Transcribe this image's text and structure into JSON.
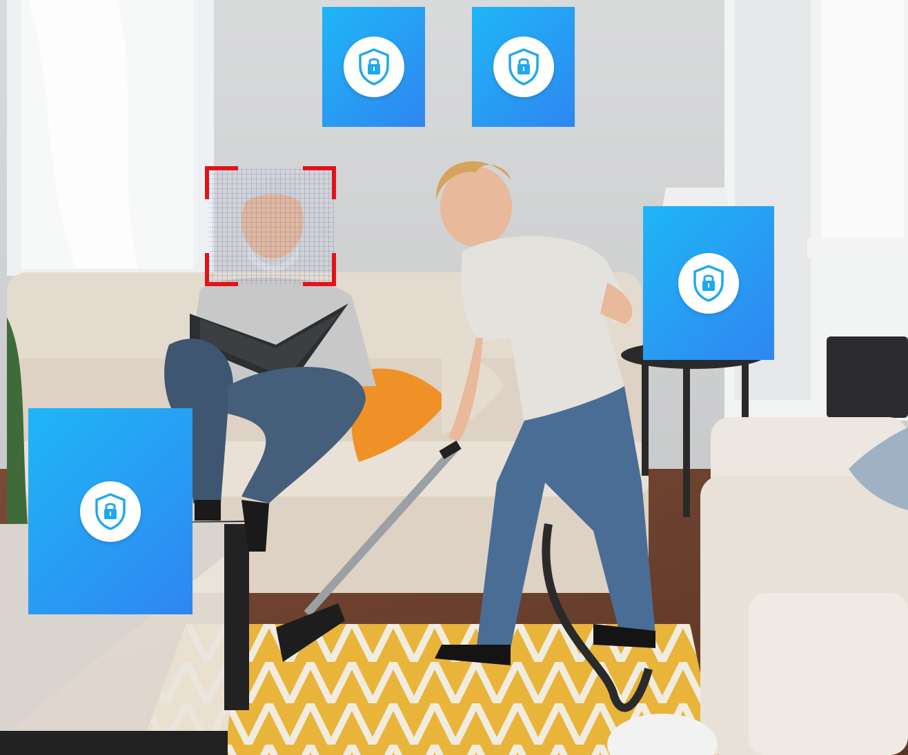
{
  "scene": {
    "description_icon_set": [
      "shield-lock-icon"
    ],
    "colors": {
      "card_gradient_start": "#1fb6f6",
      "card_gradient_end": "#2f86f1",
      "badge_background": "#ffffff",
      "icon_color": "#1fa9ee",
      "face_frame_color": "#e3121a",
      "face_grid_color": "#3b50c8"
    }
  },
  "privacy_cards": [
    {
      "id": "top-left",
      "icon": "shield-lock-icon"
    },
    {
      "id": "top-right",
      "icon": "shield-lock-icon"
    },
    {
      "id": "right",
      "icon": "shield-lock-icon"
    },
    {
      "id": "bottom-left",
      "icon": "shield-lock-icon"
    }
  ],
  "face_detection": {
    "icon": "face-scan-frame"
  }
}
